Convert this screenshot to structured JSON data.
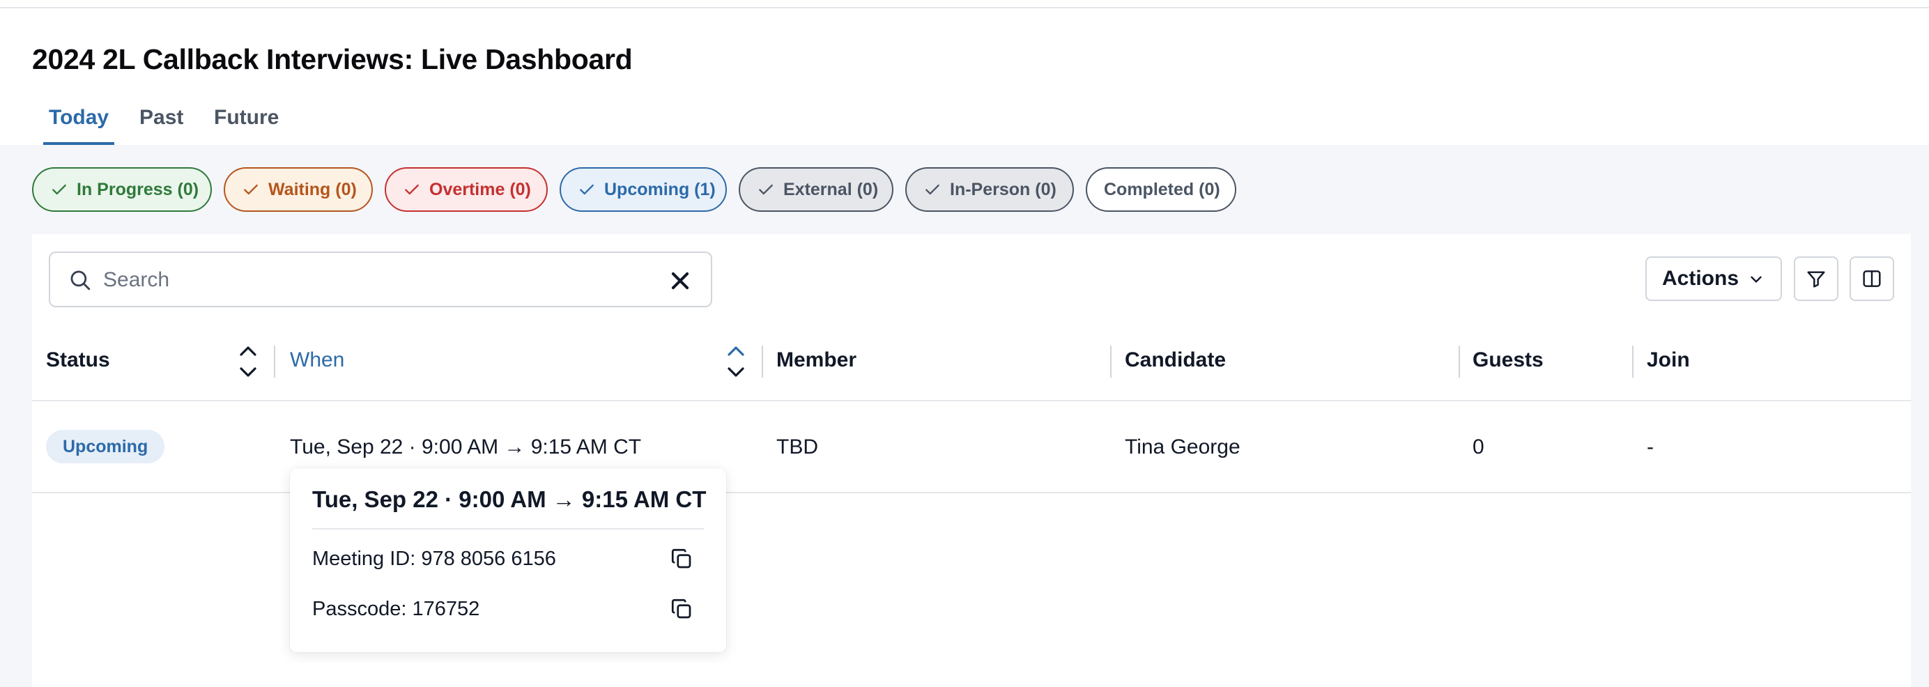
{
  "page": {
    "title": "2024 2L Callback Interviews: Live Dashboard",
    "tabs": [
      {
        "label": "Today",
        "active": true
      },
      {
        "label": "Past",
        "active": false
      },
      {
        "label": "Future",
        "active": false
      }
    ]
  },
  "filters": [
    {
      "label": "In Progress (0)",
      "icon": "check-icon",
      "color": "#2f7a3a",
      "bg": "#eaf6ec",
      "border": "#2f7a3a"
    },
    {
      "label": "Waiting (0)",
      "icon": "check-icon",
      "color": "#b5561c",
      "bg": "#fdf1e4",
      "border": "#b5561c"
    },
    {
      "label": "Overtime (0)",
      "icon": "check-icon",
      "color": "#c53030",
      "bg": "#fdeaea",
      "border": "#c53030"
    },
    {
      "label": "Upcoming (1)",
      "icon": "check-icon",
      "color": "#2c6aa8",
      "bg": "#e8f0fa",
      "border": "#2c6aa8"
    },
    {
      "label": "External (0)",
      "icon": "check-icon",
      "color": "#4b5563",
      "bg": "#e5e7eb",
      "border": "#4b5563"
    },
    {
      "label": "In-Person (0)",
      "icon": "check-icon",
      "color": "#4b5563",
      "bg": "#e5e7eb",
      "border": "#4b5563"
    },
    {
      "label": "Completed (0)",
      "icon": null,
      "color": "#4b5563",
      "bg": "#ffffff",
      "border": "#4b5563"
    }
  ],
  "toolbar": {
    "search_placeholder": "Search",
    "search_value": "",
    "actions_label": "Actions",
    "filter_icon": "filter-icon",
    "columns_icon": "columns-icon"
  },
  "table": {
    "columns": [
      "Status",
      "When",
      "Member",
      "Candidate",
      "Guests",
      "Join"
    ],
    "sorted_column": "When",
    "rows": [
      {
        "status": "Upcoming",
        "when": "Tue, Sep 22 · 9:00 AM → 9:15 AM CT",
        "member": "TBD",
        "candidate": "Tina George",
        "guests": "0",
        "join": "-"
      }
    ]
  },
  "popover": {
    "title": "Tue, Sep 22 · 9:00 AM → 9:15 AM CT",
    "meeting_id": "Meeting ID: 978 8056 6156",
    "passcode": "Passcode: 176752"
  },
  "colors": {
    "accent": "#2c6aa8",
    "content_bg": "#f4f6fa"
  }
}
